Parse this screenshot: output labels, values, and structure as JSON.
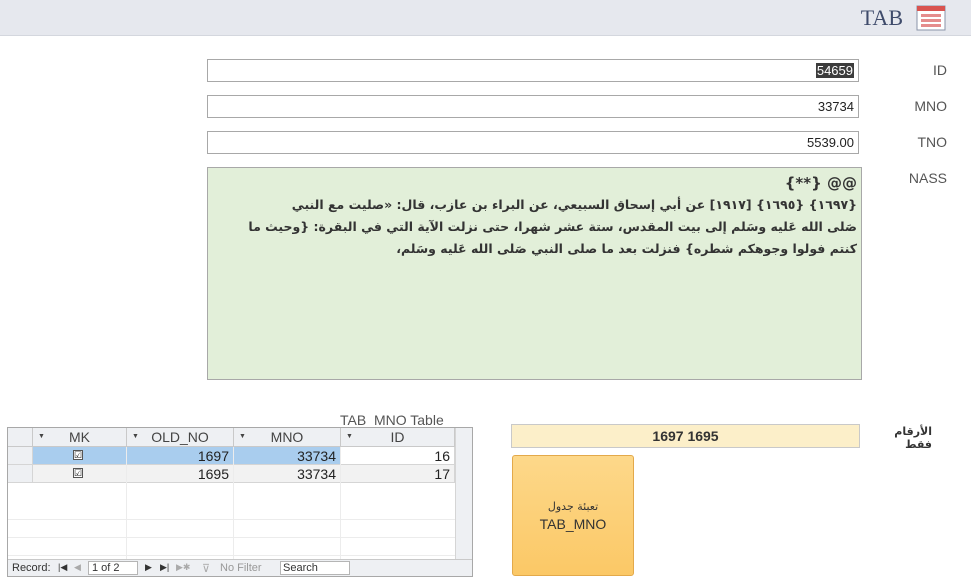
{
  "header": {
    "title": "TAB",
    "icon": "form-icon"
  },
  "form": {
    "id_label": "ID",
    "id_value": "54659",
    "mno_label": "MNO",
    "mno_value": "33734",
    "tno_label": "TNO",
    "tno_value": "5539.00",
    "nass_label": "NASS",
    "nass_lines": [
      "@@ {**}",
      "{١٦٩٧} {١٦٩٥} [١٩١٧] عن أبي إسحاق السبيعي، عن البراء بن عازب، قال: «صليت مع النبي",
      "صَلى الله عَليه وسَلم إلى بيت المقدس، ستة عشر شهرا، حتى نزلت الآية التي في البقرة: {وحيث ما",
      "كنتم فولوا وجوهكم شطره} فنزلت بعد ما صلى النبي صَلى الله عَليه وسَلم،"
    ]
  },
  "subtable": {
    "caption": "TAB_MNO Table",
    "columns": [
      "MK",
      "OLD_NO",
      "MNO",
      "ID"
    ],
    "rows": [
      {
        "mk": "☑",
        "old_no": "1697",
        "mno": "33734",
        "id": "16"
      },
      {
        "mk": "☑",
        "old_no": "1695",
        "mno": "33734",
        "id": "17"
      }
    ],
    "nav": {
      "record_label": "Record:",
      "position": "1 of 2",
      "filter_label": "No Filter",
      "search_label": "Search"
    }
  },
  "numbers_only": {
    "label": "الأرقام فقط",
    "value": "1697 1695"
  },
  "fill_button": {
    "label_ar": "تعبئة جدول",
    "label_en": "TAB_MNO"
  },
  "colors": {
    "selected_row": "#a9cdee",
    "nass_bg": "#e2efd9",
    "numbers_bg": "#fcefc9",
    "button_bg": "#fbc866"
  }
}
